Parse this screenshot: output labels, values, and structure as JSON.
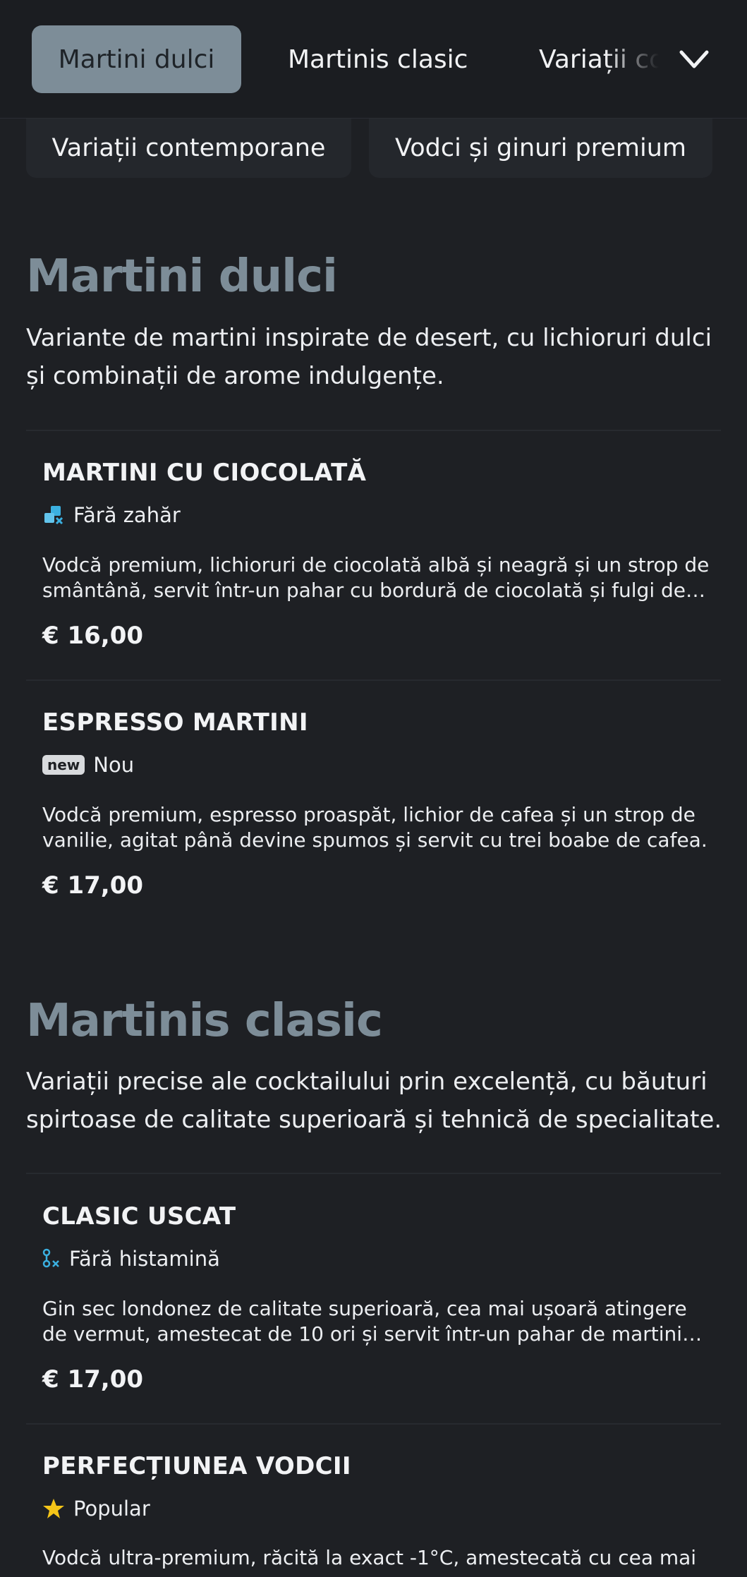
{
  "nav": {
    "tabs": [
      {
        "label": "Martini dulci",
        "active": true
      },
      {
        "label": "Martinis clasic",
        "active": false
      },
      {
        "label": "Variații contemporane",
        "active": false
      }
    ],
    "chips": [
      "Variații contemporane",
      "Vodci și ginuri premium"
    ],
    "expand_icon": "chevron-down-icon"
  },
  "sections": [
    {
      "title": "Martini dulci",
      "description": "Variante de martini inspirate de desert, cu lichioruri dulci și combinații de arome indulgențe.",
      "items": [
        {
          "name": "MARTINI CU CIOCOLATĂ",
          "badge_icon": "sugar-free-icon",
          "badge": "Fără zahăr",
          "description": "Vodcă premium, lichioruri de ciocolată albă și neagră și un strop de smântână, servit într-un pahar cu bordură de ciocolată și fulgi de ciocolată.",
          "price": "€ 16,00"
        },
        {
          "name": "ESPRESSO MARTINI",
          "badge_icon": "new-tag-icon",
          "badge_tag": "new",
          "badge": "Nou",
          "description": "Vodcă premium, espresso proaspăt, lichior de cafea și un strop de vanilie, agitat până devine spumos și servit cu trei boabe de cafea.",
          "price": "€ 17,00"
        }
      ]
    },
    {
      "title": "Martinis clasic",
      "description": "Variații precise ale cocktailului prin excelență, cu băuturi spirtoase de calitate superioară și tehnică de specialitate.",
      "items": [
        {
          "name": "CLASIC USCAT",
          "badge_icon": "histamine-free-icon",
          "badge": "Fără histamină",
          "description": "Gin sec londonez de calitate superioară, cea mai ușoară atingere de vermut, amestecat de 10 ori și servit într-un pahar de martini răcit.",
          "price": "€ 17,00"
        },
        {
          "name": "PERFECȚIUNEA VODCII",
          "badge_icon": "star-icon",
          "badge": "Popular",
          "description": "Vodcă ultra-premium, răcită la exact -1°C, amestecată cu cea mai"
        }
      ]
    }
  ],
  "colors": {
    "background": "#1e2024",
    "accent": "#7d8d98",
    "badge_icon": "#3bb0e0",
    "star": "#f5c518"
  }
}
